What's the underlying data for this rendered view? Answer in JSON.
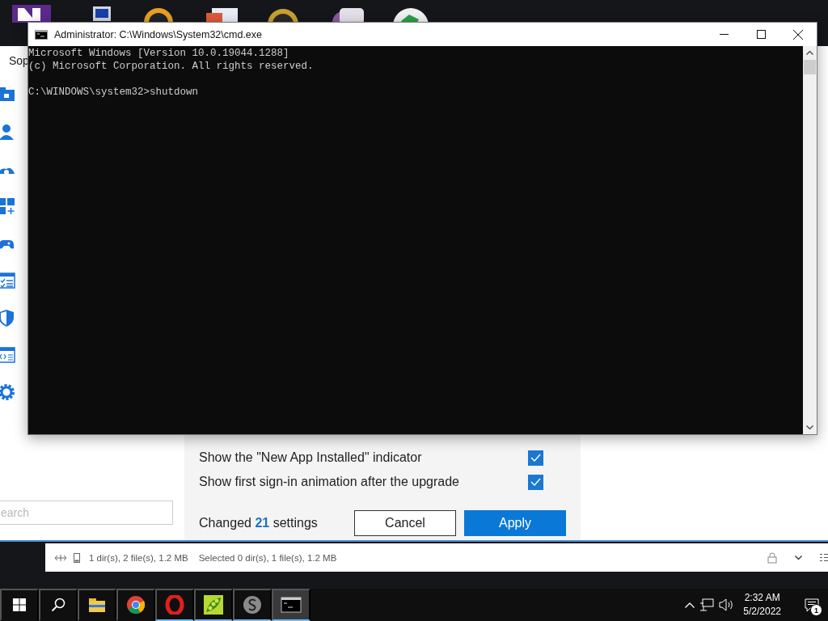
{
  "settings_window": {
    "title": "Sop",
    "options": [
      {
        "label": "Show the \"New App Installed\" indicator",
        "checked": true
      },
      {
        "label": "Show first sign-in animation after the upgrade",
        "checked": true
      }
    ],
    "search": {
      "placeholder": "earch"
    },
    "footer": {
      "prefix": "Changed",
      "count": "21",
      "suffix": "settings"
    },
    "buttons": [
      {
        "label": "Cancel",
        "kind": "secondary"
      },
      {
        "label": "Apply",
        "kind": "primary"
      }
    ]
  },
  "console_window": {
    "title": "Administrator: C:\\Windows\\System32\\cmd.exe",
    "lines": [
      {
        "text": "Microsoft Windows [Version 10.0.19044.1288]",
        "kind": "output"
      },
      {
        "text": "(c) Microsoft Corporation. All rights reserved.",
        "kind": "output"
      },
      {
        "text": "C:\\WINDOWS\\system32>shutdown",
        "kind": "prompt"
      }
    ]
  },
  "status_bar": {
    "items": [
      "1 dir(s), 2 file(s), 1.2 MB",
      "Selected 0 dir(s), 1 file(s), 1.2 MB"
    ]
  },
  "taskbar": {
    "apps": [
      {
        "kind": "explorer",
        "running": false,
        "selected": false
      },
      {
        "kind": "chrome",
        "running": false,
        "selected": false
      },
      {
        "kind": "opera",
        "running": true,
        "selected": false
      },
      {
        "kind": "pea",
        "running": true,
        "selected": false
      },
      {
        "kind": "s",
        "running": true,
        "selected": false
      },
      {
        "kind": "console",
        "running": true,
        "selected": true
      }
    ],
    "clock": {
      "time": "2:32 AM",
      "date": "5/2/2022"
    },
    "notifications": {
      "count": "1"
    }
  }
}
